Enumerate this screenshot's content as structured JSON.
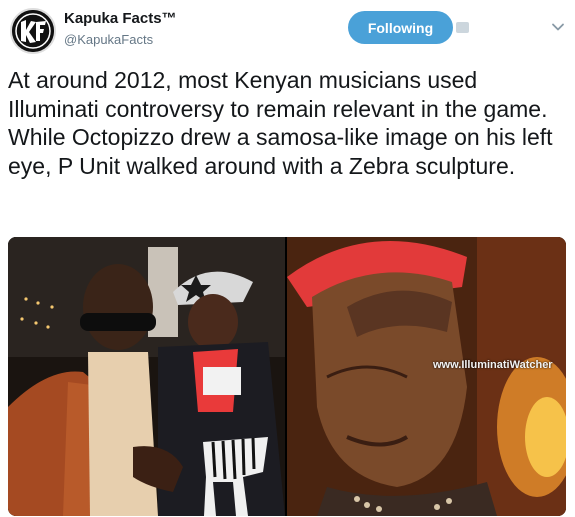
{
  "account": {
    "name": "Kapuka Facts™",
    "handle": "@KapukaFacts",
    "avatar_icon": "kf-logo-icon"
  },
  "actions": {
    "follow_label": "Following"
  },
  "tweet": {
    "text": "At around 2012, most Kenyan musicians used Illuminati controversy to remain relevant in the game. While Octopizzo drew a samosa-like image on his left eye, P Unit walked around with a Zebra sculpture."
  },
  "media": {
    "photo_right_watermark": "www.IlluminatiWatcher"
  },
  "colors": {
    "follow_button": "#4aa1d8",
    "text": "#14171a",
    "secondary": "#657786"
  }
}
